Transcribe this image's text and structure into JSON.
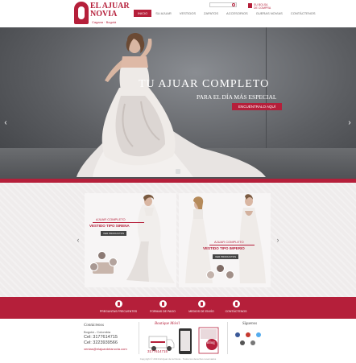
{
  "brand": {
    "line1": "EL AJUAR",
    "line2": "NOVIA",
    "tagline": "Cagana · Bogotá"
  },
  "nav": [
    "INICIO",
    "SU AJUAR",
    "VESTIDOS",
    "ZAPATOS",
    "ACCESORIOS",
    "GUERAS NOVIAS",
    "CONTÁCTENOS"
  ],
  "cart_label": "SU BOLSA DE COMPRA",
  "hero": {
    "title": "TU AJUAR COMPLETO",
    "subtitle": "PARA EL DÍA MÁS ESPECIAL",
    "cta": "ENCUÉNTRALO AQUÍ",
    "prev": "‹",
    "next": "›"
  },
  "promos": [
    {
      "eyebrow": "AJUAR COMPLETO",
      "headline": "VESTIDO TIPO SIRENA",
      "button": "VER PRODUCTOS"
    },
    {
      "eyebrow": "AJUAR COMPLETO",
      "headline": "VESTIDO TIPO IMPERIO",
      "button": "VER PRODUCTOS"
    }
  ],
  "promo_nav": {
    "prev": "‹",
    "next": "›"
  },
  "quick_links": [
    {
      "label": "PREGUNTAS FRECUENTES",
      "icon": "question-icon"
    },
    {
      "label": "FORMAS DE PAGO",
      "icon": "card-icon"
    },
    {
      "label": "MEDIOS DE ENVÍO",
      "icon": "truck-icon"
    },
    {
      "label": "CONTÁCTENOS",
      "icon": "phone-icon"
    }
  ],
  "footer": {
    "contact_title": "Contáctenos",
    "city": "Bogotá - Colombia",
    "phone1": "Cel: 3177614715",
    "phone2": "Cel: 3223939566",
    "email": "ventas@elajuardelanovia.com",
    "mobile_title": "Boutique Móvil",
    "mobile_phone": "3177614715",
    "blog_label": "Blog",
    "follow_title": "Síguenos",
    "copyright": "Copyright © 2013 El Ajuar de la Novia · Todos los derechos reservados"
  },
  "colors": {
    "accent": "#b51f3a",
    "background": "#efecec"
  }
}
